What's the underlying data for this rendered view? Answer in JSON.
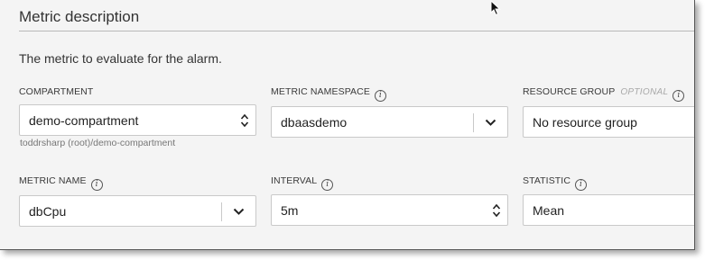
{
  "section": {
    "title": "Metric description",
    "description": "The metric to evaluate for the alarm."
  },
  "compartment": {
    "label": "COMPARTMENT",
    "value": "demo-compartment",
    "hint": "toddrsharp (root)/demo-compartment"
  },
  "metric_namespace": {
    "label": "METRIC NAMESPACE",
    "value": "dbaasdemo"
  },
  "resource_group": {
    "label": "RESOURCE GROUP",
    "optional": "OPTIONAL",
    "placeholder": "No resource group"
  },
  "metric_name": {
    "label": "METRIC NAME",
    "value": "dbCpu"
  },
  "interval": {
    "label": "INTERVAL",
    "value": "5m"
  },
  "statistic": {
    "label": "STATISTIC",
    "value": "Mean"
  },
  "info_glyph": "i",
  "icons": [
    "info-icon",
    "chevron-down-icon",
    "up-down-stepper-icon",
    "mouse-pointer-icon"
  ]
}
